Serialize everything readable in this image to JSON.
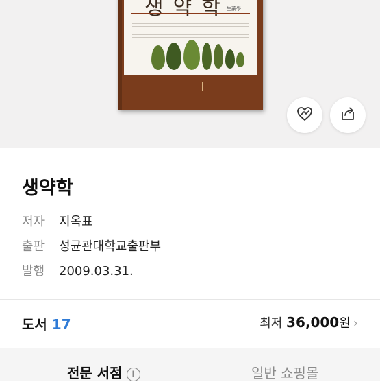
{
  "book": {
    "cover_title": "생약학",
    "cover_subtitle": "生藥學",
    "title": "생약학",
    "author_label": "저자",
    "author": "지옥표",
    "publisher_label": "출판",
    "publisher": "성균관대학교출판부",
    "date_label": "발행",
    "date": "2009.03.31."
  },
  "stats": {
    "label": "도서",
    "count": "17",
    "price_prefix": "최저",
    "price": "36,000",
    "price_unit": "원",
    "chevron": "›"
  },
  "tabs": {
    "active": "전문 서점",
    "inactive": "일반 쇼핑몰",
    "info_icon": "i"
  },
  "icons": {
    "like": "heart-icon",
    "share": "share-icon"
  },
  "colors": {
    "accent": "#2f7bd6",
    "cover": "#7a3c1c"
  }
}
